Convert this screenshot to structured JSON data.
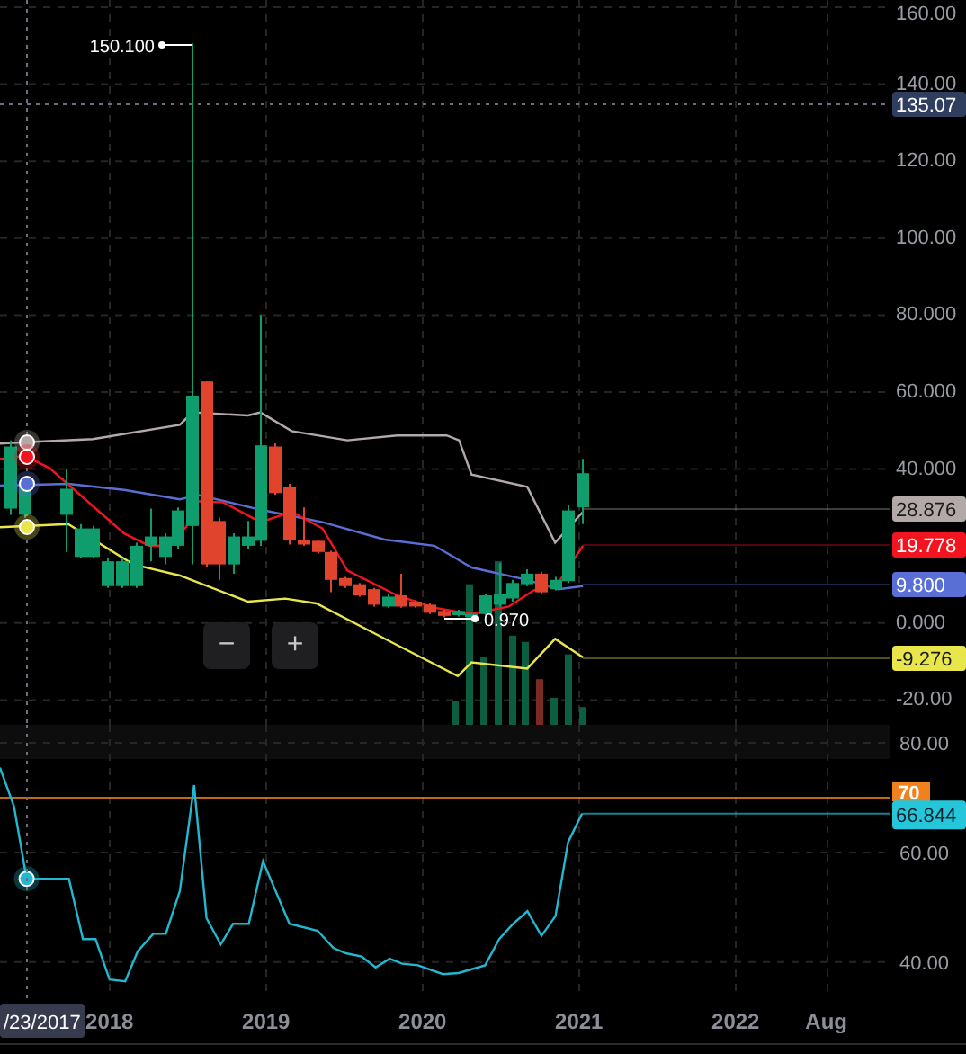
{
  "price_panel": {
    "high_label": "150.100",
    "low_label": "0.970",
    "axis_labels": [
      "160.00",
      "140.00",
      "120.00",
      "100.00",
      "80.000",
      "60.000",
      "40.000",
      "0.000",
      "-20.00"
    ],
    "badges": [
      {
        "text": "135.07",
        "color": "#2f3d5f"
      },
      {
        "text": "28.876",
        "color": "#b4a9a9"
      },
      {
        "text": "19.778",
        "color": "#f2151f"
      },
      {
        "text": "9.800",
        "color": "#5a6fd6"
      },
      {
        "text": "-9.276",
        "color": "#e8e64b"
      }
    ],
    "zoom_buttons": [
      "−",
      "+"
    ]
  },
  "rsi_panel": {
    "chart_data": {
      "type": "line",
      "grid": true,
      "ref_lines": [
        {
          "axis": "y",
          "value": 70,
          "color": "#f0821e"
        }
      ],
      "xlim": [
        2017.3,
        2022.99
      ],
      "ylim": [
        33.4,
        83.3
      ],
      "yticks": [
        {
          "value": 80,
          "label": "80.00"
        },
        {
          "value": 60,
          "label": "60.00"
        },
        {
          "value": 40,
          "label": "40.00"
        }
      ],
      "xticks": [
        {
          "value": 2018,
          "label": "2018"
        },
        {
          "value": 2019,
          "label": "2019"
        },
        {
          "value": 2020,
          "label": "2020"
        },
        {
          "value": 2021,
          "label": "2021"
        },
        {
          "value": 2022,
          "label": "2022"
        },
        {
          "value": 2022.58,
          "label": "Aug"
        }
      ],
      "x": [
        2017.3,
        2017.39,
        2017.47,
        2017.74,
        2017.83,
        2017.91,
        2018.0,
        2018.1,
        2018.18,
        2018.28,
        2018.36,
        2018.45,
        2018.54,
        2018.62,
        2018.71,
        2018.79,
        2018.89,
        2018.98,
        2019.15,
        2019.33,
        2019.43,
        2019.51,
        2019.61,
        2019.7,
        2019.79,
        2019.87,
        2019.97,
        2020.13,
        2020.23,
        2020.4,
        2020.49,
        2020.58,
        2020.67,
        2020.76,
        2020.85,
        2020.93,
        2021.02
      ],
      "series": [
        {
          "color": "#22b8cf",
          "values": [
            75.5,
            68.4,
            55.2,
            55.2,
            44.2,
            44.2,
            36.8,
            36.5,
            42,
            45.2,
            45.2,
            53,
            72.3,
            48,
            43.2,
            47,
            47,
            58.4,
            47,
            45.7,
            42.6,
            41.6,
            41,
            39,
            40.6,
            39.7,
            39.4,
            37.8,
            38,
            39.4,
            44.2,
            47,
            49.3,
            44.8,
            48.4,
            61.9,
            67.1
          ]
        }
      ]
    },
    "badges": [
      {
        "text": "70",
        "color": "#f0821e"
      },
      {
        "text": "66.844",
        "color": "#26c6da"
      }
    ]
  },
  "time_axis": {
    "cursor_label": "/23/2017"
  }
}
